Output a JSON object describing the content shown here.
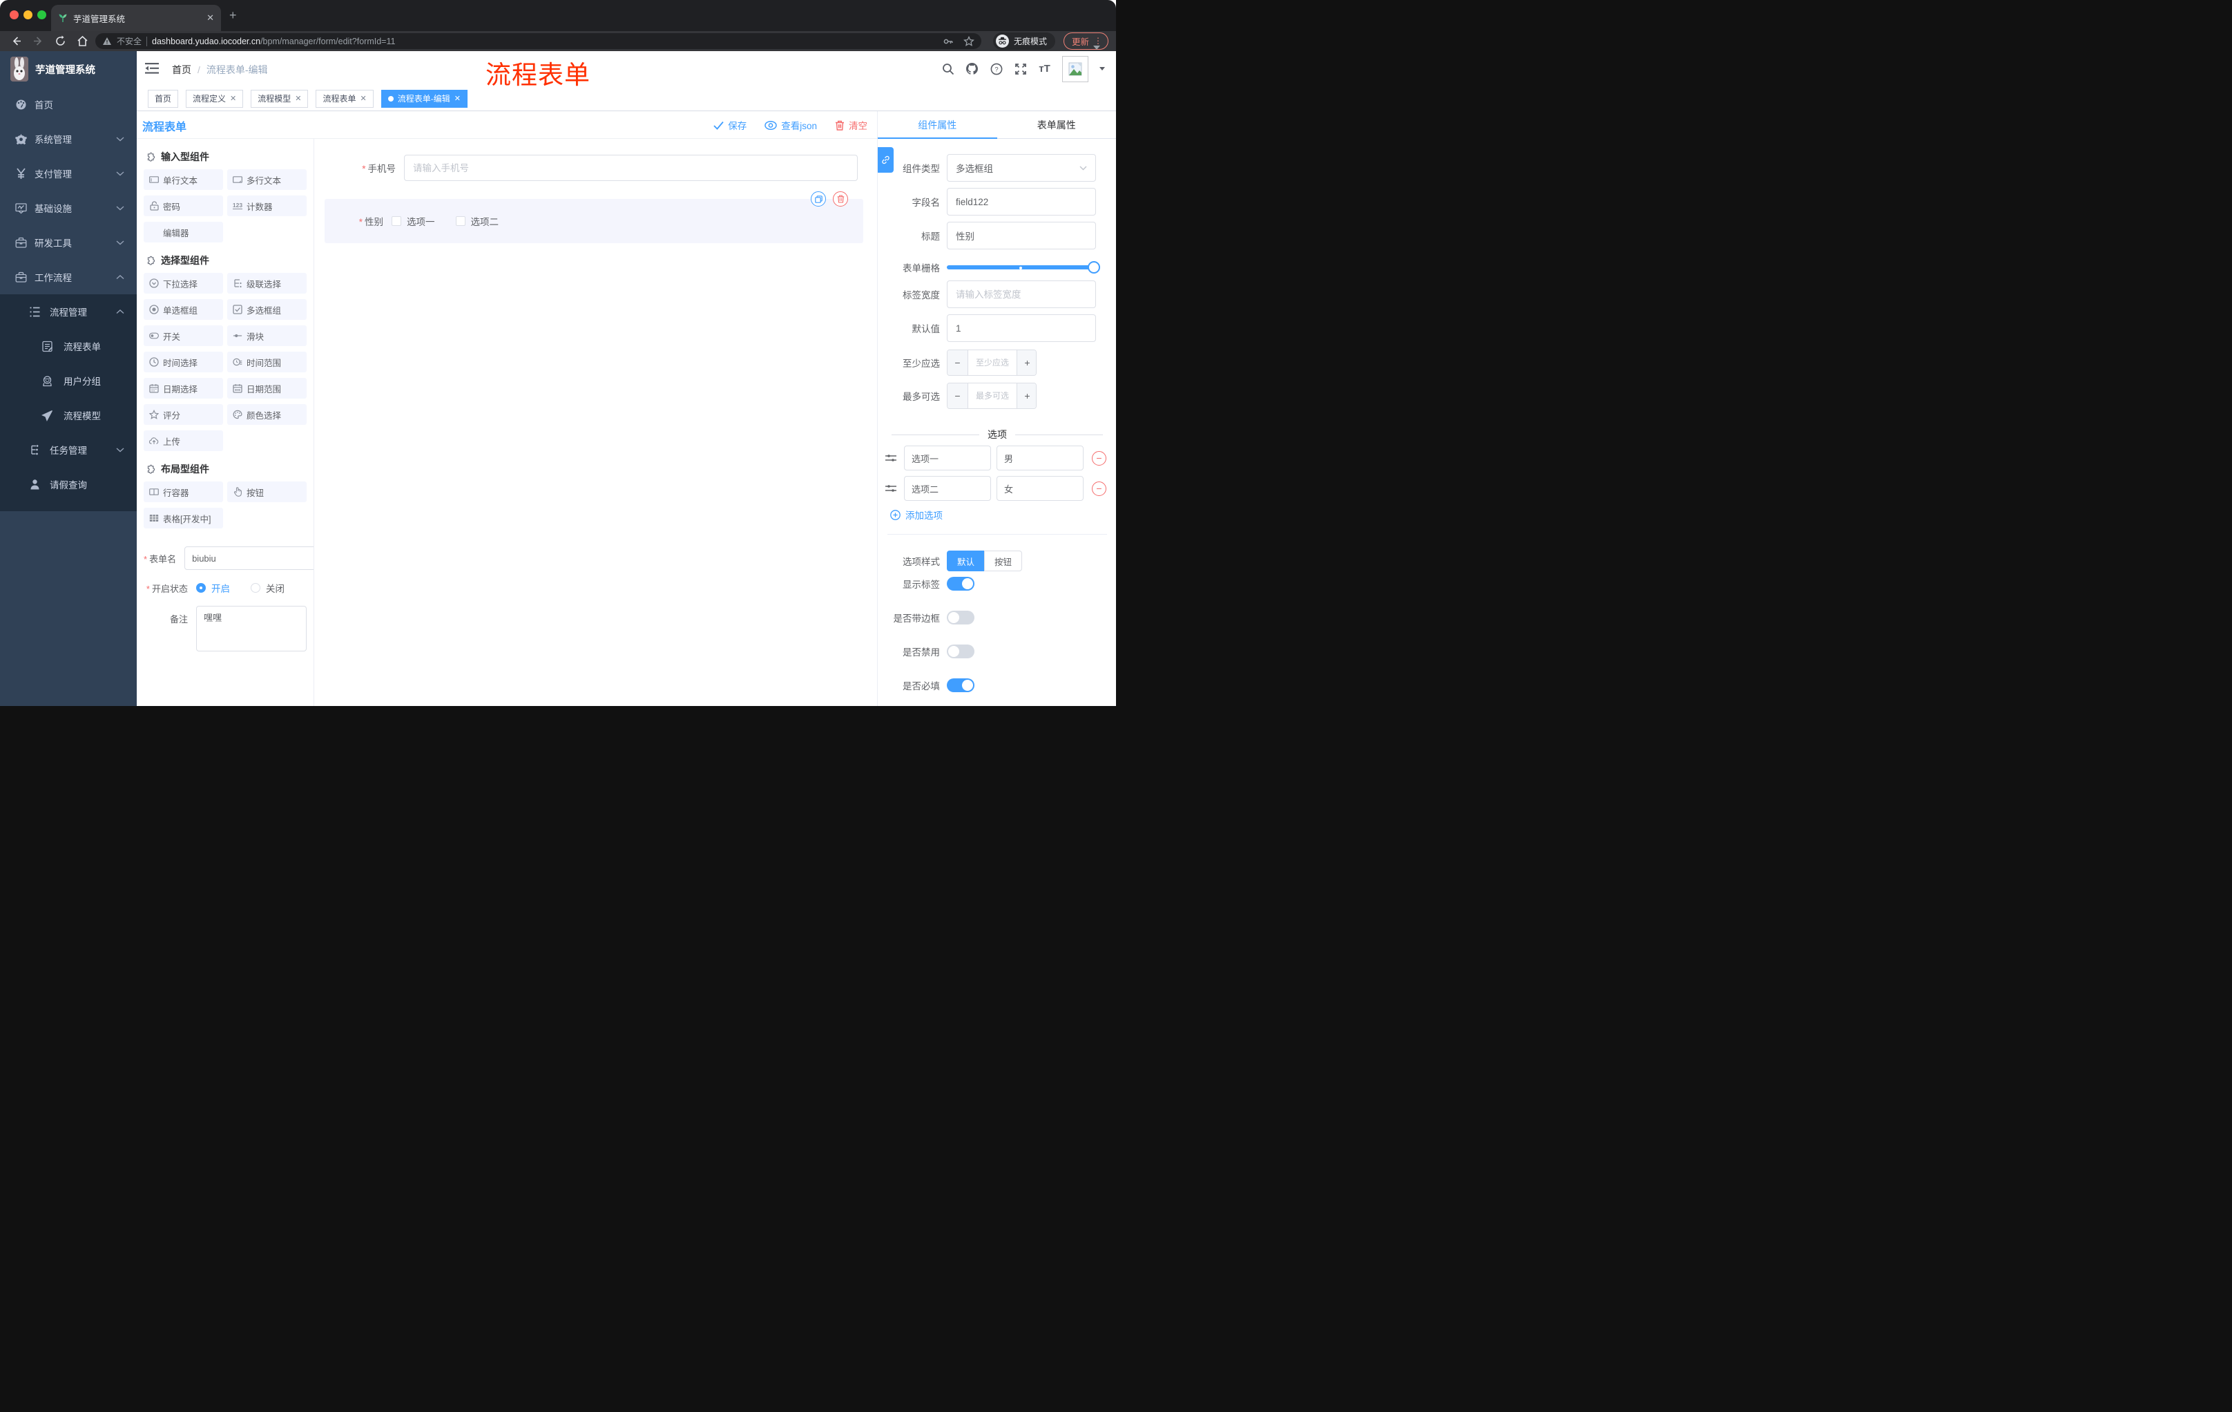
{
  "chrome": {
    "tab_title": "芋道管理系统",
    "security_label": "不安全",
    "url_host": "dashboard.yudao.iocoder.cn",
    "url_path": "/bpm/manager/form/edit?formId=11",
    "incognito_label": "无痕模式",
    "update_label": "更新"
  },
  "sidebar": {
    "logo_title": "芋道管理系统",
    "menu": [
      {
        "label": "首页",
        "icon": "dashboard",
        "level": 1,
        "chevron": "",
        "dark": false
      },
      {
        "label": "系统管理",
        "icon": "gear",
        "level": 1,
        "chevron": "down",
        "dark": false
      },
      {
        "label": "支付管理",
        "icon": "yen",
        "level": 1,
        "chevron": "down",
        "dark": false
      },
      {
        "label": "基础设施",
        "icon": "monitor",
        "level": 1,
        "chevron": "down",
        "dark": false
      },
      {
        "label": "研发工具",
        "icon": "briefcase",
        "level": 1,
        "chevron": "down",
        "dark": false
      },
      {
        "label": "工作流程",
        "icon": "briefcase",
        "level": 1,
        "chevron": "up",
        "dark": false
      },
      {
        "label": "流程管理",
        "icon": "list-check",
        "level": 2,
        "chevron": "up",
        "dark": true
      },
      {
        "label": "流程表单",
        "icon": "form-doc",
        "level": 3,
        "chevron": "",
        "dark": true
      },
      {
        "label": "用户分组",
        "icon": "user-group",
        "level": 3,
        "chevron": "",
        "dark": true
      },
      {
        "label": "流程模型",
        "icon": "paper-plane",
        "level": 3,
        "chevron": "",
        "dark": true
      },
      {
        "label": "任务管理",
        "icon": "tree",
        "level": 2,
        "chevron": "down",
        "dark": true
      },
      {
        "label": "请假查询",
        "icon": "person",
        "level": 2,
        "chevron": "",
        "dark": true
      }
    ]
  },
  "header": {
    "breadcrumb_home": "首页",
    "breadcrumb_current": "流程表单-编辑",
    "annotation": "流程表单"
  },
  "page_tabs": [
    {
      "label": "首页",
      "closable": false,
      "active": false
    },
    {
      "label": "流程定义",
      "closable": true,
      "active": false
    },
    {
      "label": "流程模型",
      "closable": true,
      "active": false
    },
    {
      "label": "流程表单",
      "closable": true,
      "active": false
    },
    {
      "label": "流程表单-编辑",
      "closable": true,
      "active": true
    }
  ],
  "designer": {
    "title": "流程表单",
    "save_label": "保存",
    "view_json_label": "查看json",
    "clear_label": "清空"
  },
  "components_panel": {
    "sections": [
      {
        "title": "输入型组件",
        "items": [
          {
            "label": "单行文本",
            "icon": "input"
          },
          {
            "label": "多行文本",
            "icon": "textarea"
          },
          {
            "label": "密码",
            "icon": "lock"
          },
          {
            "label": "计数器",
            "icon": "counter"
          },
          {
            "label": "编辑器",
            "icon": "none"
          }
        ]
      },
      {
        "title": "选择型组件",
        "items": [
          {
            "label": "下拉选择",
            "icon": "select"
          },
          {
            "label": "级联选择",
            "icon": "cascade"
          },
          {
            "label": "单选框组",
            "icon": "radio"
          },
          {
            "label": "多选框组",
            "icon": "checkbox"
          },
          {
            "label": "开关",
            "icon": "switch"
          },
          {
            "label": "滑块",
            "icon": "slider"
          },
          {
            "label": "时间选择",
            "icon": "time"
          },
          {
            "label": "时间范围",
            "icon": "time-range"
          },
          {
            "label": "日期选择",
            "icon": "date"
          },
          {
            "label": "日期范围",
            "icon": "date-range"
          },
          {
            "label": "评分",
            "icon": "star"
          },
          {
            "label": "颜色选择",
            "icon": "palette"
          },
          {
            "label": "上传",
            "icon": "upload"
          }
        ]
      },
      {
        "title": "布局型组件",
        "items": [
          {
            "label": "行容器",
            "icon": "row"
          },
          {
            "label": "按钮",
            "icon": "hand"
          },
          {
            "label": "表格[开发中]",
            "icon": "table"
          }
        ]
      }
    ],
    "form": {
      "name_label": "表单名",
      "name_value": "biubiu",
      "status_label": "开启状态",
      "status_on": "开启",
      "status_off": "关闭",
      "remark_label": "备注",
      "remark_value": "嘿嘿"
    }
  },
  "canvas": {
    "phone_label": "手机号",
    "phone_placeholder": "请输入手机号",
    "gender_label": "性别",
    "gender_option1": "选项一",
    "gender_option2": "选项二"
  },
  "props_panel": {
    "tab_component": "组件属性",
    "tab_form": "表单属性",
    "component_type_label": "组件类型",
    "component_type_value": "多选框组",
    "field_name_label": "字段名",
    "field_name_value": "field122",
    "title_label": "标题",
    "title_value": "性别",
    "grid_label": "表单栅格",
    "label_width_label": "标签宽度",
    "label_width_placeholder": "请输入标签宽度",
    "default_label": "默认值",
    "default_value": "1",
    "min_label": "至少应选",
    "min_placeholder": "至少应选",
    "max_label": "最多可选",
    "max_placeholder": "最多可选",
    "options_title": "选项",
    "options": [
      {
        "label": "选项一",
        "value": "男"
      },
      {
        "label": "选项二",
        "value": "女"
      }
    ],
    "add_option_label": "添加选项",
    "option_style_label": "选项样式",
    "option_style_default": "默认",
    "option_style_button": "按钮",
    "switches": [
      {
        "label": "显示标签",
        "on": true
      },
      {
        "label": "是否带边框",
        "on": false
      },
      {
        "label": "是否禁用",
        "on": false
      },
      {
        "label": "是否必填",
        "on": true
      }
    ]
  },
  "colors": {
    "accent_blue": "#409eff",
    "danger_red": "#f56c6c",
    "annotation_red": "#ff3000",
    "sidebar_bg": "#304156",
    "submenu_bg": "#1f2d3d"
  }
}
